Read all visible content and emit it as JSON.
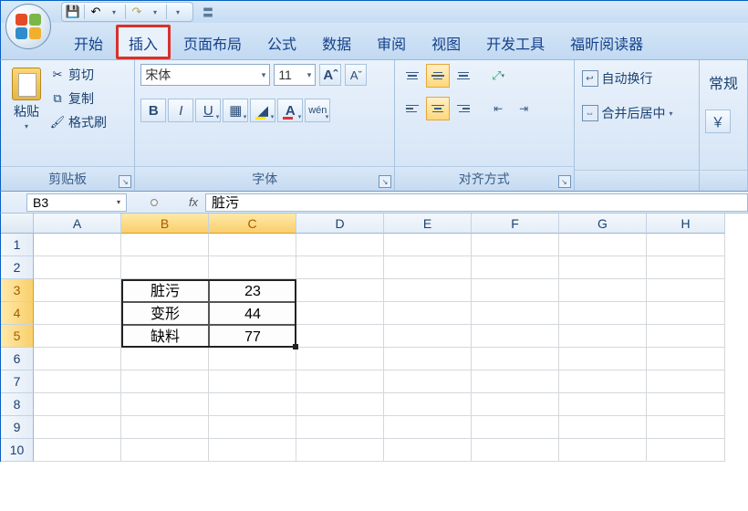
{
  "qat": {
    "labels": {}
  },
  "tabs": [
    "开始",
    "插入",
    "页面布局",
    "公式",
    "数据",
    "审阅",
    "视图",
    "开发工具",
    "福昕阅读器"
  ],
  "highlighted_tab_index": 1,
  "ribbon": {
    "clipboard": {
      "paste": "粘贴",
      "cut": "剪切",
      "copy": "复制",
      "format_painter": "格式刷",
      "group_label": "剪贴板"
    },
    "font": {
      "name": "宋体",
      "size": "11",
      "group_label": "字体",
      "bold": "B",
      "italic": "I",
      "underline": "U"
    },
    "alignment": {
      "group_label": "对齐方式",
      "wrap_text": "自动换行",
      "merge_center": "合并后居中"
    },
    "number": {
      "format_label": "常规"
    }
  },
  "namebox": "B3",
  "formula": "脏污",
  "columns": [
    "A",
    "B",
    "C",
    "D",
    "E",
    "F",
    "G",
    "H"
  ],
  "rows": [
    "1",
    "2",
    "3",
    "4",
    "5",
    "6",
    "7",
    "8",
    "9",
    "10"
  ],
  "selected_columns": [
    "B",
    "C"
  ],
  "selected_rows": [
    "3",
    "4",
    "5"
  ],
  "active_cell": "B3",
  "cells": {
    "B3": "脏污",
    "C3": "23",
    "B4": "变形",
    "C4": "44",
    "B5": "缺料",
    "C5": "77"
  },
  "chart_data": {
    "type": "table",
    "categories": [
      "脏污",
      "变形",
      "缺料"
    ],
    "values": [
      23,
      44,
      77
    ]
  }
}
